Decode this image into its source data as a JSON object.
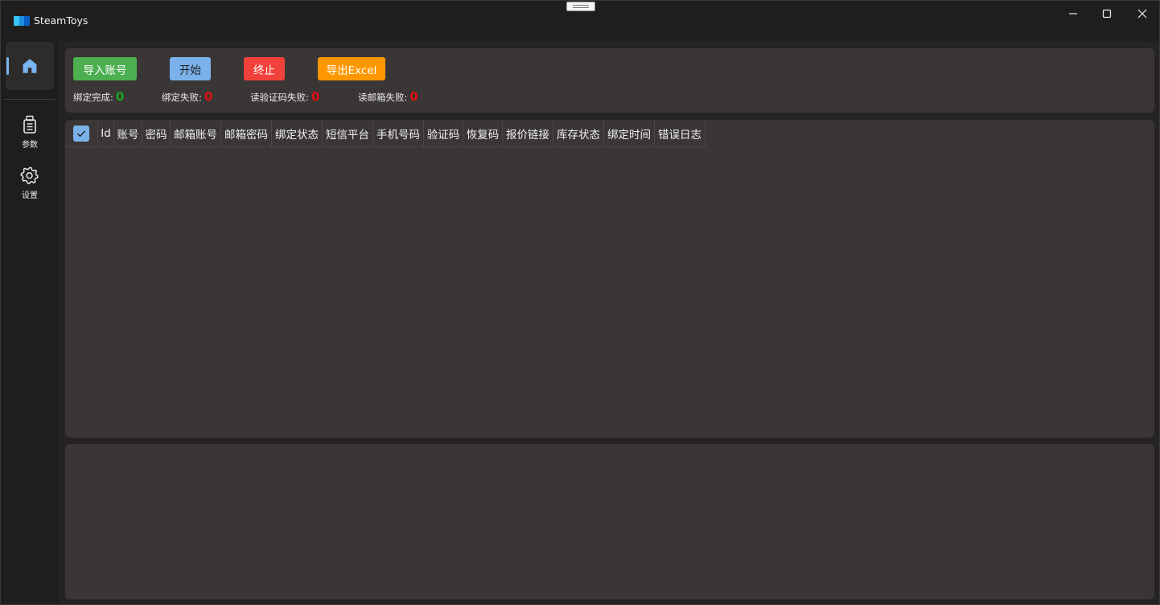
{
  "app": {
    "title": "SteamToys"
  },
  "colors": {
    "accent": "#7ab1ea",
    "success": "#4caf50",
    "danger": "#f1413b",
    "warning": "#ff9800",
    "stat_ok": "#1fa31f",
    "stat_fail": "#e01010"
  },
  "sidebar": {
    "items": [
      {
        "icon": "home-icon",
        "label": ""
      },
      {
        "icon": "params-icon",
        "label": "参数"
      },
      {
        "icon": "gear-icon",
        "label": "设置"
      }
    ]
  },
  "toolbar": {
    "import_label": "导入账号",
    "start_label": "开始",
    "stop_label": "终止",
    "export_label": "导出Excel"
  },
  "stats": {
    "bind_done_label": "绑定完成:",
    "bind_done_value": "0",
    "bind_fail_label": "绑定失败:",
    "bind_fail_value": "0",
    "read_code_fail_label": "读验证码失败:",
    "read_code_fail_value": "0",
    "read_mail_fail_label": "读邮箱失败:",
    "read_mail_fail_value": "0"
  },
  "table": {
    "select_all_checked": true,
    "columns": [
      "Id",
      "账号",
      "密码",
      "邮箱账号",
      "邮箱密码",
      "绑定状态",
      "短信平台",
      "手机号码",
      "验证码",
      "恢复码",
      "报价链接",
      "库存状态",
      "绑定时间",
      "错误日志"
    ],
    "rows": []
  }
}
